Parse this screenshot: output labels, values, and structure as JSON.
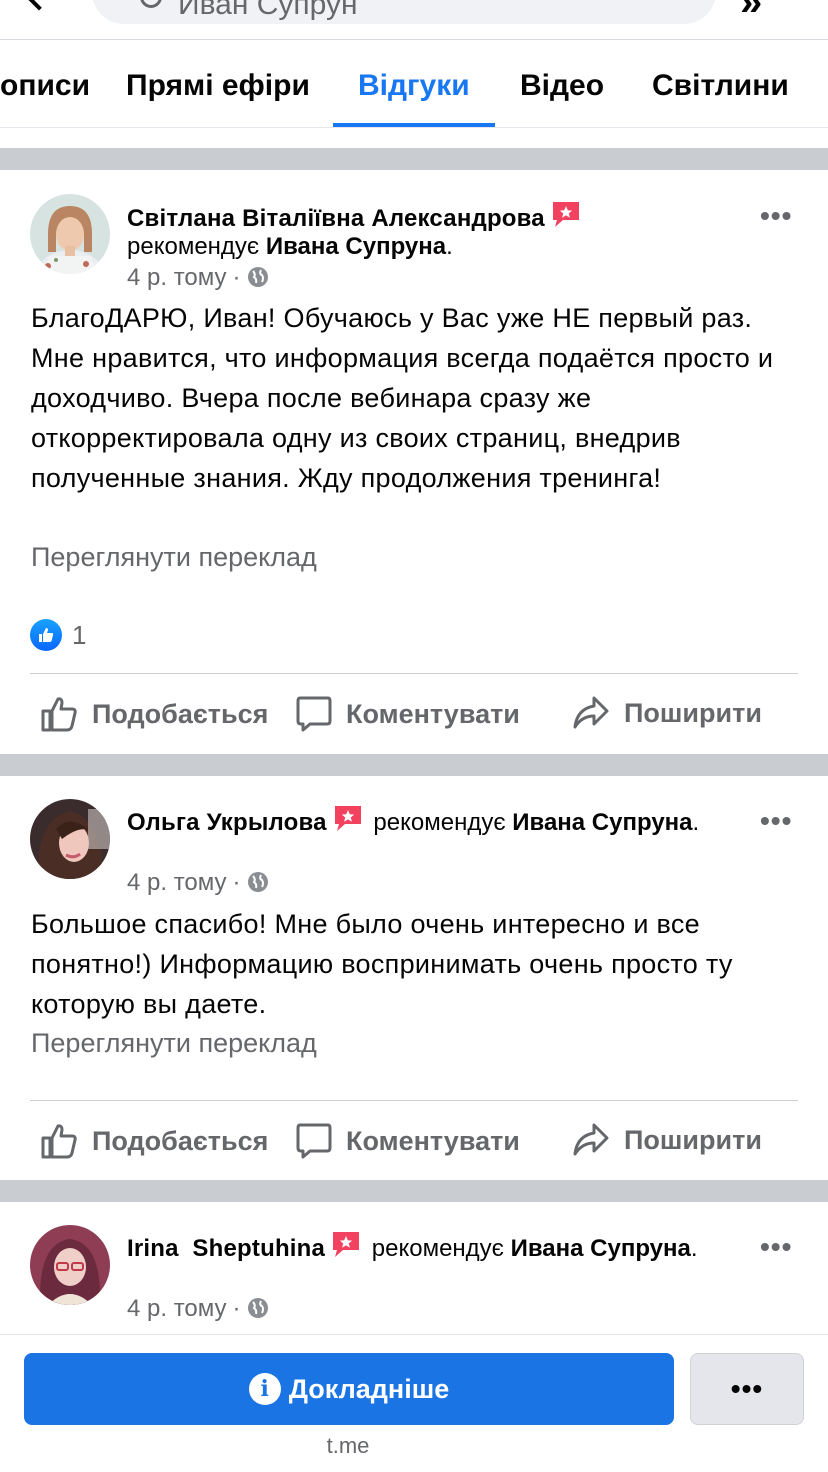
{
  "search": {
    "query": "Иван Супрун"
  },
  "tabs": [
    {
      "label": "Дописи",
      "display": "описи"
    },
    {
      "label": "Прямі ефіри"
    },
    {
      "label": "Відгуки"
    },
    {
      "label": "Відео"
    },
    {
      "label": "Світлини"
    }
  ],
  "active_tab": "Відгуки",
  "colors": {
    "accent": "#1877f2",
    "recommend_badge": "#f3425f",
    "button": "#1b74e4",
    "secondary_text": "#65676b"
  },
  "posts": [
    {
      "author": "Світлана Віталіївна Александрова",
      "rec_word": "рекомендує",
      "recipient": "Ивана Супруна",
      "time": "4 р. тому",
      "body": "БлагоДАРЮ, Иван! Обучаюсь у Вас уже НЕ первый раз. Мне нравится, что информация всегда подаётся просто и доходчиво. Вчера после вебинара сразу же откорректировала одну из своих страниц, внедрив полученные знания. Жду продолжения тренинга!",
      "translate": "Переглянути переклад",
      "reaction_count": "1"
    },
    {
      "author": "Ольга Укрылова",
      "rec_word": "рекомендує",
      "recipient": "Ивана Супруна",
      "time": "4 р. тому",
      "body": "Большое спасибо! Мне было очень интересно и все понятно!) Информацию воспринимать очень просто ту которую вы даете.",
      "translate": "Переглянути переклад"
    },
    {
      "author": "Irina  Sheptuhina",
      "rec_word": "рекомендує",
      "recipient": "Ивана Супруна",
      "time": "4 р. тому"
    }
  ],
  "actions": {
    "like": "Подобається",
    "comment": "Коментувати",
    "share": "Поширити"
  },
  "bottom": {
    "cta_label": "Докладніше",
    "more_label": "•••",
    "domain": "t.me"
  },
  "icons": [
    "back-arrow-icon",
    "search-icon",
    "share-icon",
    "recommend-icon",
    "globe-icon",
    "more-icon",
    "like-reaction-icon",
    "thumbs-up-icon",
    "comment-icon",
    "share-arrow-icon",
    "info-icon"
  ]
}
